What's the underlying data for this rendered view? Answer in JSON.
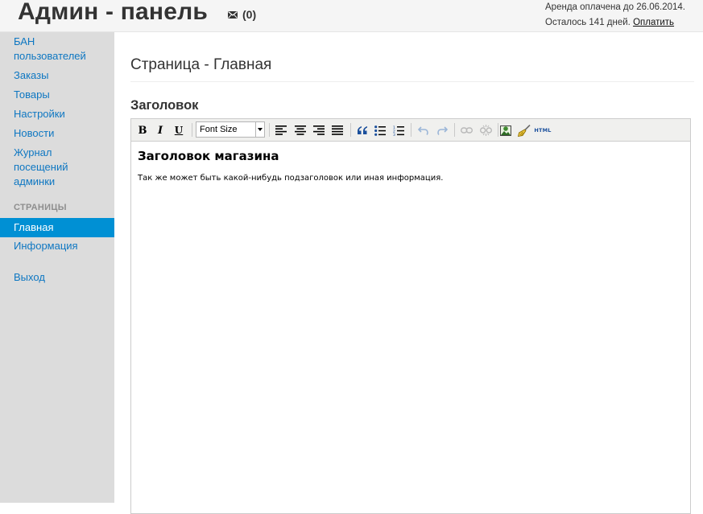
{
  "header": {
    "title": "Админ - панель",
    "mail_count": "(0)",
    "rent_paid": "Аренда оплачена до 26.06.2014.",
    "days_left": "Осталось 141 дней.",
    "pay_link": "Оплатить"
  },
  "sidebar": {
    "items": [
      {
        "label": "БАН пользователей"
      },
      {
        "label": "Заказы"
      },
      {
        "label": "Товары"
      },
      {
        "label": "Настройки"
      },
      {
        "label": "Новости"
      },
      {
        "label": "Журнал посещений админки"
      }
    ],
    "section_header": "СТРАНИЦЫ",
    "pages": [
      {
        "label": "Главная",
        "active": true
      },
      {
        "label": "Информация",
        "active": false
      }
    ],
    "logout": "Выход"
  },
  "main": {
    "page_title": "Страница - Главная",
    "field_label": "Заголовок"
  },
  "editor": {
    "font_size_placeholder": "Font Size",
    "bold": "B",
    "italic": "I",
    "underline": "U",
    "html_label": "HTML",
    "content_heading": "Заголовок магазина",
    "content_text": "Так же может быть какой-нибудь подзаголовок или иная информация."
  },
  "colors": {
    "accent": "#0090d4",
    "link": "#0e77c2",
    "sidebar_bg": "#dcdcdc",
    "header_bg": "#f5f5f5",
    "toolbar_bg": "#f0f0ee"
  }
}
